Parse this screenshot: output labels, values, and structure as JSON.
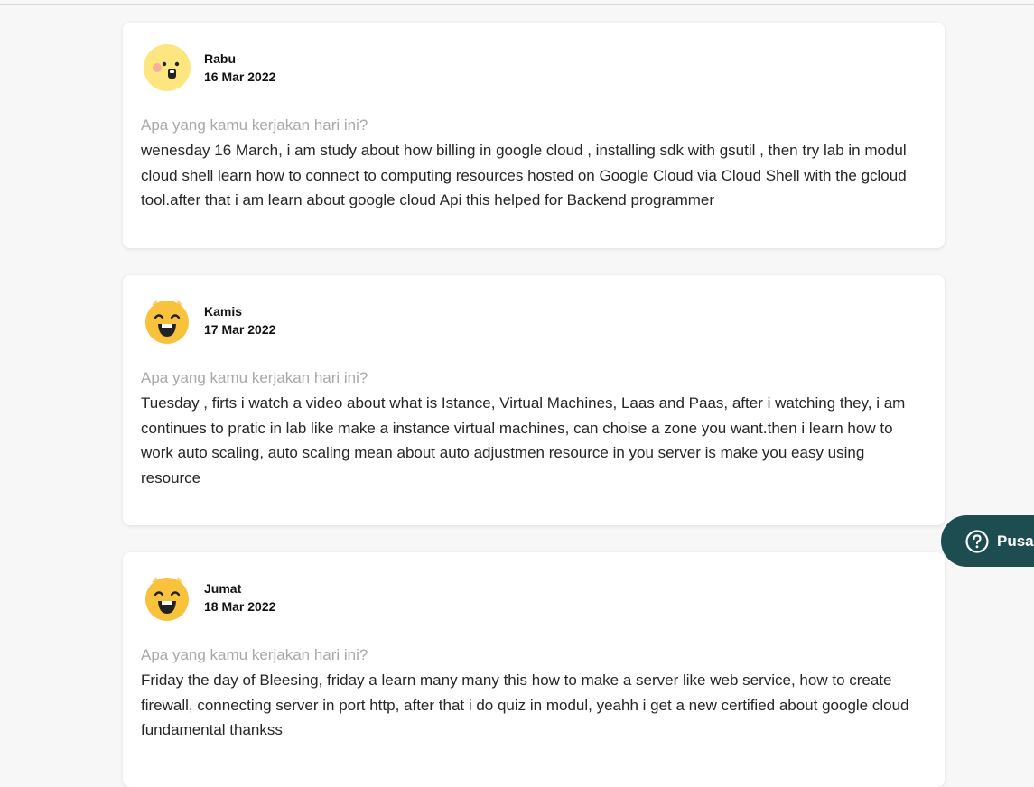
{
  "entries": [
    {
      "day": "Rabu",
      "date": "16 Mar 2022",
      "mood_icon": "surprised-face-icon",
      "question": "Apa yang kamu kerjakan hari ini?",
      "answer": "wenesday 16 March, i am study about how billing in google cloud , installing sdk with gsutil , then try lab in modul cloud shell learn how to connect to computing resources hosted on Google Cloud via Cloud Shell with the gcloud tool.after that i am learn about google cloud Api this helped for Backend programmer"
    },
    {
      "day": "Kamis",
      "date": "17 Mar 2022",
      "mood_icon": "excited-face-icon",
      "question": "Apa yang kamu kerjakan hari ini?",
      "answer": "Tuesday , firts i watch a video about what is Istance, Virtual Machines, Laas and Paas, after i watching they, i am continues to pratic in lab like make a instance virtual machines, can choise a zone you want.then i learn how to work auto scaling, auto scaling mean about auto adjustmen resource in you server is make you easy using resource"
    },
    {
      "day": "Jumat",
      "date": "18 Mar 2022",
      "mood_icon": "excited-face-icon",
      "question": "Apa yang kamu kerjakan hari ini?",
      "answer": "Friday the day of  Bleesing, friday a learn many many this how to make a server like web service, how to create firewall, connecting server in port http, after that i do quiz in modul, yeahh i get a new certified about google cloud fundamental thankss"
    }
  ],
  "help_button": {
    "label": "Pusa",
    "icon": "question-circle-icon",
    "color": "#1e4d51"
  },
  "colors": {
    "question_text": "#a6a8ab",
    "answer_text": "#262626",
    "card_bg": "#ffffff",
    "page_bg": "#f7f7f7"
  }
}
